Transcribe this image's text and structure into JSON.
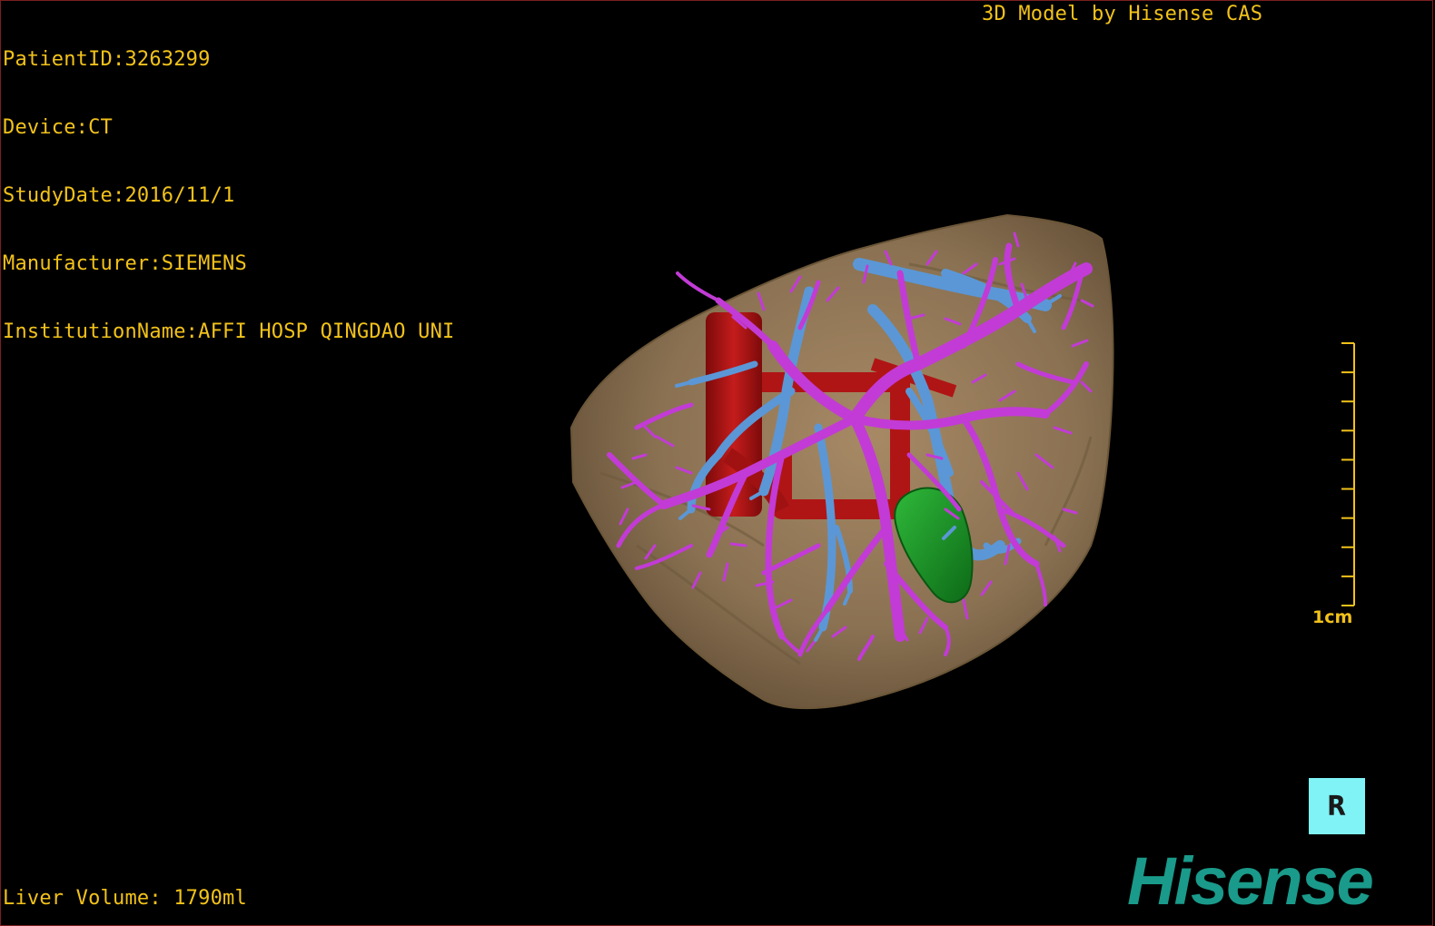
{
  "header": {
    "patient_id": "PatientID:3263299",
    "device": "Device:CT",
    "study_date": "StudyDate:2016/11/1",
    "manufacturer": "Manufacturer:SIEMENS",
    "institution": "InstitutionName:AFFI HOSP QINGDAO UNI"
  },
  "credit": "3D Model by Hisense CAS",
  "footer": {
    "liver_volume": "Liver Volume: 1790ml"
  },
  "scale": {
    "label": "1cm",
    "ticks": 10
  },
  "orientation": {
    "label": "R",
    "icon": "orientation-cube-icon"
  },
  "logo": {
    "text": "Hisense"
  },
  "colors": {
    "overlay_text": "#f2c21a",
    "liver": "#8a7152",
    "portal_vein": "#c23bd6",
    "hepatic_vein": "#5b97d6",
    "ivc": "#b01515",
    "gallbladder": "#1f9a2a",
    "cube": "#7ff3f5",
    "logo": "#1a9a8a"
  }
}
